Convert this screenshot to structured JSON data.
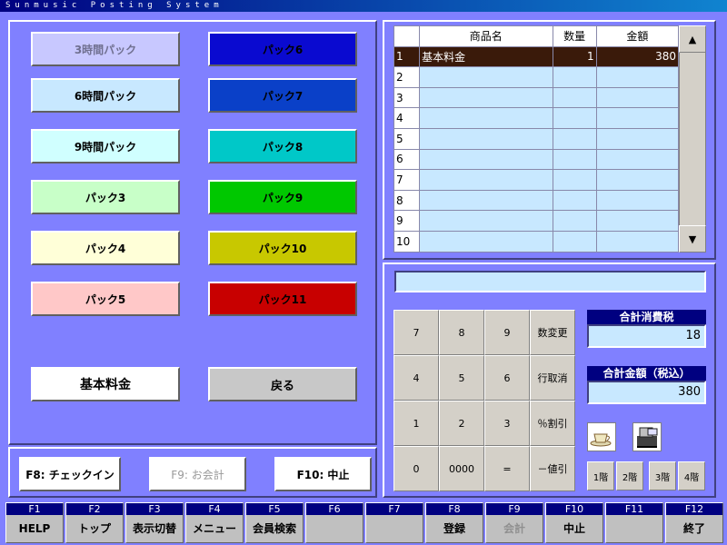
{
  "window": {
    "title": "Sunmusic Posting System"
  },
  "packs": [
    {
      "label": "3時間パック",
      "bg": "#c8c8ff",
      "disabled": true
    },
    {
      "label": "パック6",
      "bg": "#0a0ad0"
    },
    {
      "label": "6時間パック",
      "bg": "#c8e8ff"
    },
    {
      "label": "パック7",
      "bg": "#0a40c8"
    },
    {
      "label": "9時間パック",
      "bg": "#d0ffff"
    },
    {
      "label": "パック8",
      "bg": "#00c8c8"
    },
    {
      "label": "パック3",
      "bg": "#c8ffc8"
    },
    {
      "label": "パック9",
      "bg": "#00c800"
    },
    {
      "label": "パック4",
      "bg": "#ffffd8"
    },
    {
      "label": "パック10",
      "bg": "#c8c800"
    },
    {
      "label": "パック5",
      "bg": "#ffc8c8"
    },
    {
      "label": "パック11",
      "bg": "#c80000"
    }
  ],
  "left_buttons": {
    "basic_fee": "基本料金",
    "back": "戻る"
  },
  "footer_buttons": {
    "checkin": "F8: チェックイン",
    "checkout": "F9: お会計",
    "cancel": "F10: 中止"
  },
  "table": {
    "headers": [
      "商品名",
      "数量",
      "金額"
    ],
    "rows": [
      {
        "no": "1",
        "name": "基本料金",
        "qty": "1",
        "amount": "380"
      },
      {
        "no": "2",
        "name": "",
        "qty": "",
        "amount": ""
      },
      {
        "no": "3",
        "name": "",
        "qty": "",
        "amount": ""
      },
      {
        "no": "4",
        "name": "",
        "qty": "",
        "amount": ""
      },
      {
        "no": "5",
        "name": "",
        "qty": "",
        "amount": ""
      },
      {
        "no": "6",
        "name": "",
        "qty": "",
        "amount": ""
      },
      {
        "no": "7",
        "name": "",
        "qty": "",
        "amount": ""
      },
      {
        "no": "8",
        "name": "",
        "qty": "",
        "amount": ""
      },
      {
        "no": "9",
        "name": "",
        "qty": "",
        "amount": ""
      },
      {
        "no": "10",
        "name": "",
        "qty": "",
        "amount": ""
      }
    ],
    "scroll_up": "▲",
    "scroll_down": "▼"
  },
  "keypad": [
    [
      "7",
      "8",
      "9",
      "数変更"
    ],
    [
      "4",
      "5",
      "6",
      "行取消"
    ],
    [
      "1",
      "2",
      "3",
      "％割引"
    ],
    [
      "0",
      "0000",
      "=",
      "－値引"
    ]
  ],
  "totals": {
    "tax_label": "合計消費税",
    "tax_value": "18",
    "total_label": "合計金額（税込）",
    "total_value": "380"
  },
  "floors": [
    "1階",
    "2階",
    "3階",
    "4階"
  ],
  "fkeys": [
    {
      "key": "F1",
      "label": "HELP"
    },
    {
      "key": "F2",
      "label": "トップ"
    },
    {
      "key": "F3",
      "label": "表示切替"
    },
    {
      "key": "F4",
      "label": "メニュー"
    },
    {
      "key": "F5",
      "label": "会員検索"
    },
    {
      "key": "F6",
      "label": ""
    },
    {
      "key": "F7",
      "label": ""
    },
    {
      "key": "F8",
      "label": "登録"
    },
    {
      "key": "F9",
      "label": "会計"
    },
    {
      "key": "F10",
      "label": "中止"
    },
    {
      "key": "F11",
      "label": ""
    },
    {
      "key": "F12",
      "label": "終了"
    }
  ]
}
